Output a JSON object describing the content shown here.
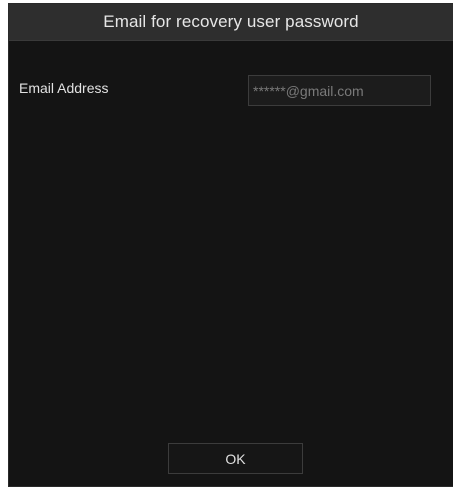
{
  "dialog": {
    "title": "Email for recovery user password",
    "email": {
      "label": "Email Address",
      "value": "******@gmail.com"
    },
    "ok_label": "OK"
  },
  "colors": {
    "background": "#141414",
    "titlebar": "#2e2e2e",
    "text": "#e6e6e6",
    "muted_text": "#7a7a7a",
    "border": "#3c3c3c"
  }
}
